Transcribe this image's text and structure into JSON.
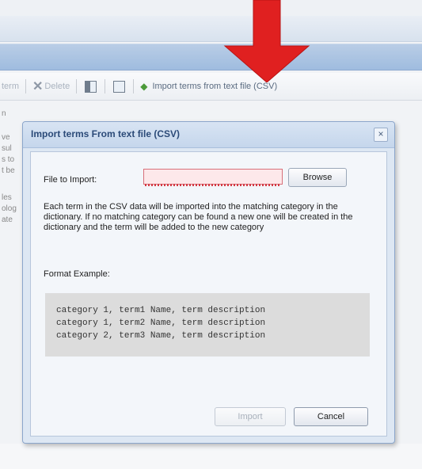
{
  "toolbar": {
    "item_term_label": "term",
    "delete_label": "Delete",
    "import_csv_label": "Import terms from text file (CSV)"
  },
  "left_panel_fragments": [
    "n",
    "ve",
    "sul",
    "s to",
    "t be",
    "les",
    "olog",
    "ate"
  ],
  "dialog": {
    "title": "Import terms From text file (CSV)",
    "close_glyph": "×",
    "file_label": "File to Import:",
    "file_value": "",
    "browse_label": "Browse",
    "description": "Each term in the CSV data will be imported into the matching category in the dictionary. If no matching category can be found a new one will be created in the dictionary and the term will be added to the new category",
    "format_label": "Format Example:",
    "example_lines": [
      "category 1, term1 Name, term description",
      "category 1, term2 Name, term description",
      "category 2, term3 Name, term description"
    ],
    "import_label": "Import",
    "cancel_label": "Cancel"
  },
  "colors": {
    "arrow": "#e02020",
    "dialog_title": "#2b4a78",
    "input_error_border": "#d8707a",
    "input_error_bg": "#fde8ea"
  },
  "icons": {
    "delete": "close-x-icon",
    "view_toggle_1": "panel-icon",
    "view_toggle_2": "columns-icon",
    "import_csv": "import-arrow-icon",
    "close": "close-icon"
  }
}
